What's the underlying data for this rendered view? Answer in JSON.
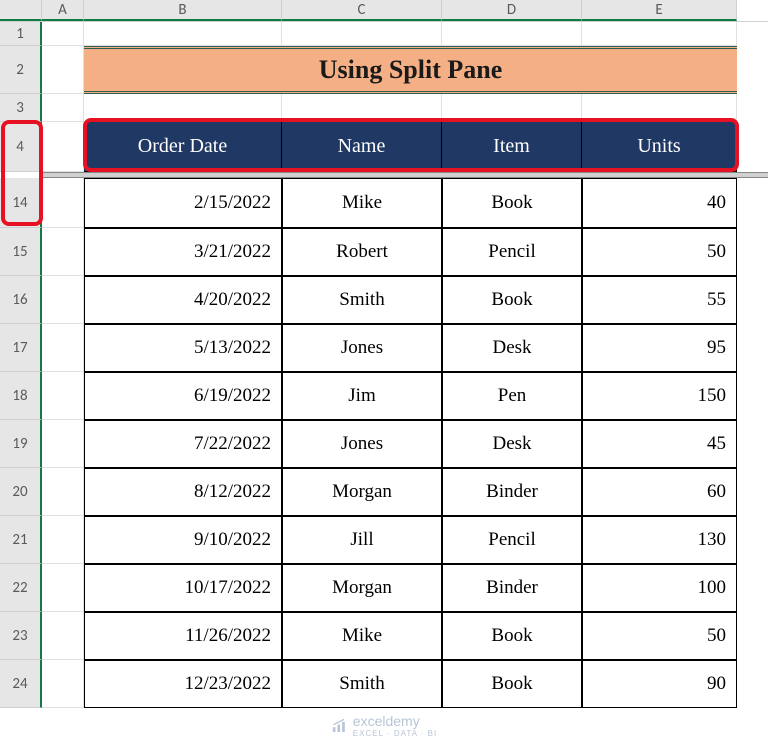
{
  "columns": [
    "A",
    "B",
    "C",
    "D",
    "E"
  ],
  "row_numbers_top": [
    "1",
    "2",
    "3",
    "4"
  ],
  "row_numbers_bottom": [
    "14",
    "15",
    "16",
    "17",
    "18",
    "19",
    "20",
    "21",
    "22",
    "23",
    "24"
  ],
  "title": "Using Split Pane",
  "table_headers": [
    "Order Date",
    "Name",
    "Item",
    "Units"
  ],
  "chart_data": {
    "type": "table",
    "columns": [
      "Order Date",
      "Name",
      "Item",
      "Units"
    ],
    "rows": [
      {
        "date": "2/15/2022",
        "name": "Mike",
        "item": "Book",
        "units": 40
      },
      {
        "date": "3/21/2022",
        "name": "Robert",
        "item": "Pencil",
        "units": 50
      },
      {
        "date": "4/20/2022",
        "name": "Smith",
        "item": "Book",
        "units": 55
      },
      {
        "date": "5/13/2022",
        "name": "Jones",
        "item": "Desk",
        "units": 95
      },
      {
        "date": "6/19/2022",
        "name": "Jim",
        "item": "Pen",
        "units": 150
      },
      {
        "date": "7/22/2022",
        "name": "Jones",
        "item": "Desk",
        "units": 45
      },
      {
        "date": "8/12/2022",
        "name": "Morgan",
        "item": "Binder",
        "units": 60
      },
      {
        "date": "9/10/2022",
        "name": "Jill",
        "item": "Pencil",
        "units": 130
      },
      {
        "date": "10/17/2022",
        "name": "Morgan",
        "item": "Binder",
        "units": 100
      },
      {
        "date": "11/26/2022",
        "name": "Mike",
        "item": "Book",
        "units": 50
      },
      {
        "date": "12/23/2022",
        "name": "Smith",
        "item": "Book",
        "units": 90
      }
    ]
  },
  "watermark": {
    "brand": "exceldemy",
    "tagline": "EXCEL · DATA · BI"
  }
}
